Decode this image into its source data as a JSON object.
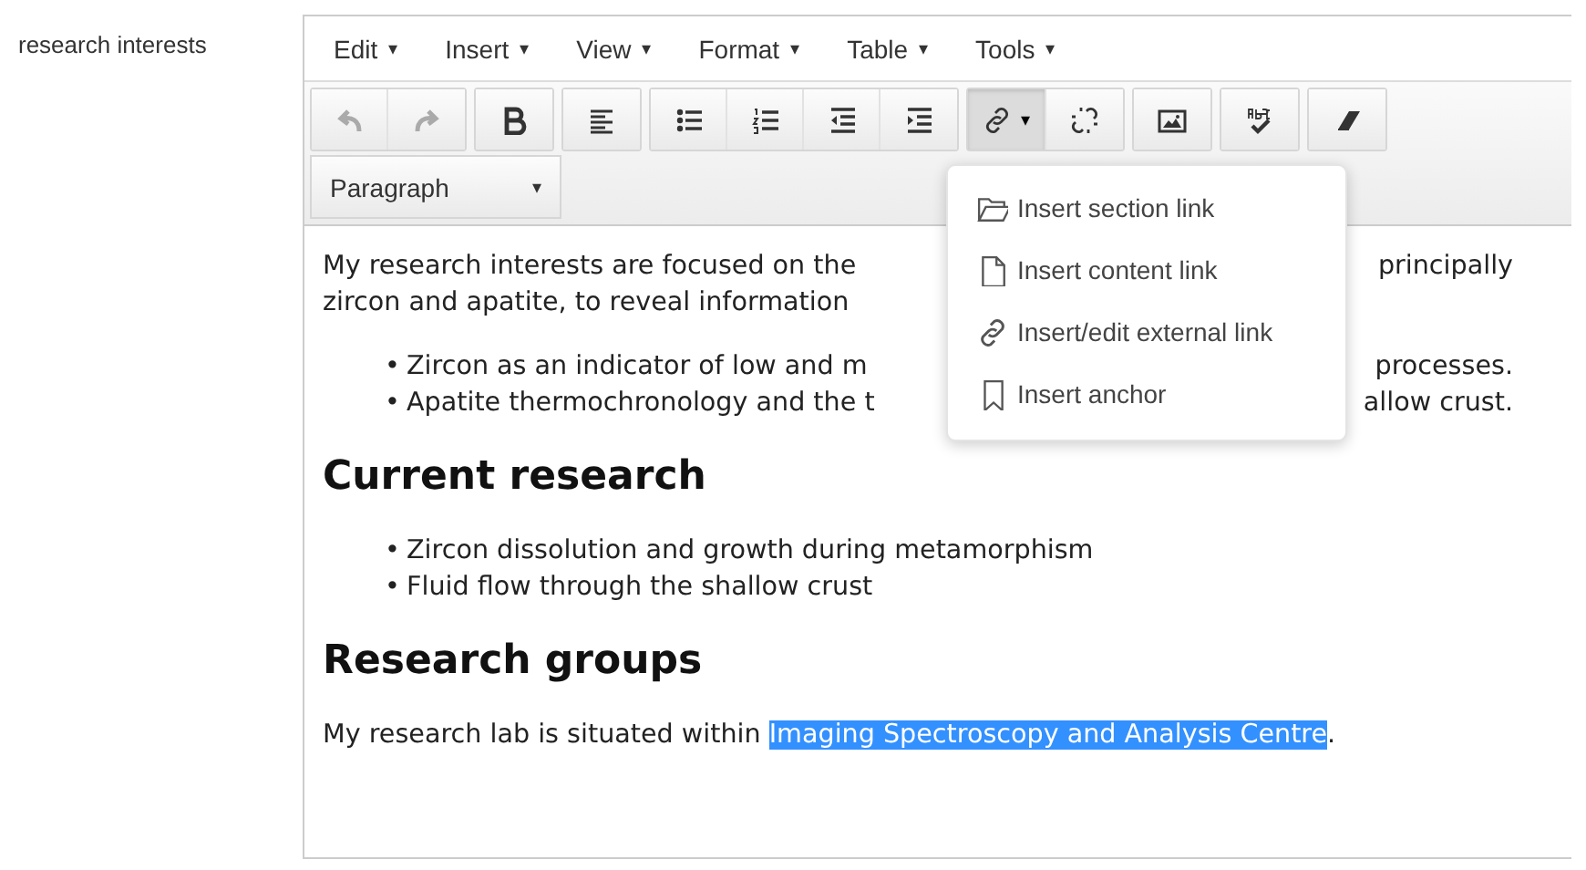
{
  "field_label": "research interests",
  "menubar": [
    {
      "label": "Edit",
      "caret": "▾"
    },
    {
      "label": "Insert",
      "caret": "▾"
    },
    {
      "label": "View",
      "caret": "▾"
    },
    {
      "label": "Format",
      "caret": "▾"
    },
    {
      "label": "Table",
      "caret": "▾"
    },
    {
      "label": "Tools",
      "caret": "▾"
    }
  ],
  "toolbar_groups": [
    [
      {
        "kind": "undo",
        "disabled": true
      },
      {
        "kind": "redo",
        "disabled": true
      }
    ],
    [
      {
        "kind": "bold",
        "disabled": false
      }
    ],
    [
      {
        "kind": "align-left",
        "disabled": false
      }
    ],
    [
      {
        "kind": "bullet-list",
        "disabled": false
      },
      {
        "kind": "numbered-list",
        "disabled": false
      },
      {
        "kind": "outdent",
        "disabled": false
      },
      {
        "kind": "indent",
        "disabled": false
      }
    ],
    [
      {
        "kind": "link",
        "disabled": false,
        "pressed": true,
        "caret": "▾"
      },
      {
        "kind": "unlink",
        "disabled": false,
        "pressed": false
      }
    ],
    [
      {
        "kind": "image",
        "disabled": false
      }
    ],
    [
      {
        "kind": "spellcheck",
        "disabled": false
      }
    ],
    [
      {
        "kind": "eraser",
        "disabled": false
      }
    ]
  ],
  "block_format": {
    "value": "Paragraph",
    "caret": "▾"
  },
  "content": [
    {
      "kind": "split-paragraph",
      "lines": [
        {
          "left": "My research interests are focused on the",
          "right": "principally"
        },
        {
          "left": "zircon and apatite, to reveal information"
        }
      ]
    },
    {
      "kind": "split-list",
      "lines": [
        {
          "bullet": "•",
          "left": "Zircon as an indicator of low and m",
          "right": "processes."
        },
        {
          "bullet": "•",
          "left": "Apatite thermochronology and the t",
          "right": "allow crust."
        }
      ]
    },
    {
      "kind": "heading",
      "text": "Current research"
    },
    {
      "kind": "list",
      "items": [
        {
          "bullet": "•",
          "text": "Zircon dissolution and growth during metamorphism"
        },
        {
          "bullet": "•",
          "text": "Fluid flow through the shallow crust"
        }
      ]
    },
    {
      "kind": "heading",
      "text": "Research groups"
    },
    {
      "kind": "paragraph",
      "parts": [
        {
          "text": "My research lab is situated within ",
          "selected": false
        },
        {
          "text": "Imaging Spectroscopy and Analysis Centre",
          "selected": true
        },
        {
          "text": ".",
          "selected": false
        }
      ]
    }
  ],
  "link_menu": [
    {
      "kind": "folder",
      "label": "Insert section link"
    },
    {
      "kind": "page",
      "label": "Insert content link"
    },
    {
      "kind": "link",
      "label": "Insert/edit external link"
    },
    {
      "kind": "bookmark",
      "label": "Insert anchor"
    }
  ]
}
